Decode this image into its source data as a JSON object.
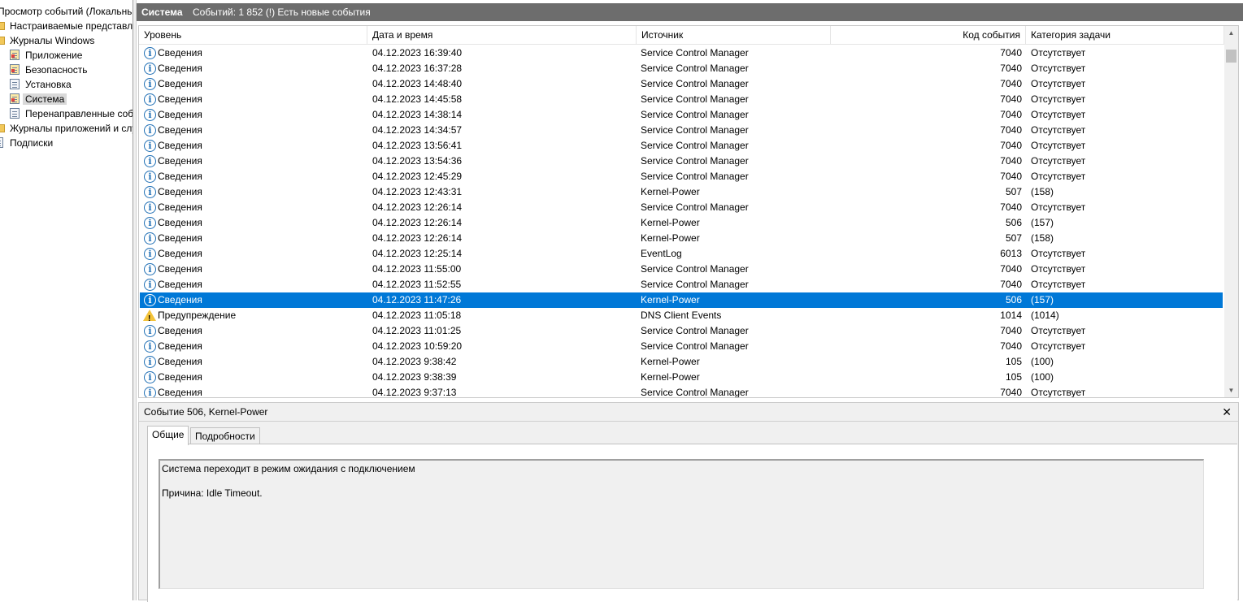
{
  "tree": {
    "root_label": "Просмотр событий (Локальный)",
    "items": [
      {
        "label": "Настраиваемые представления",
        "icon": "folder-icon"
      },
      {
        "label": "Журналы Windows",
        "icon": "folder-icon"
      },
      {
        "label": "Приложение",
        "icon": "log-icon"
      },
      {
        "label": "Безопасность",
        "icon": "log-icon"
      },
      {
        "label": "Установка",
        "icon": "log-icon"
      },
      {
        "label": "Система",
        "icon": "log-icon"
      },
      {
        "label": "Перенаправленные события",
        "icon": "log-icon"
      },
      {
        "label": "Журналы приложений и служб",
        "icon": "folder-icon"
      },
      {
        "label": "Подписки",
        "icon": "subscription-icon"
      }
    ]
  },
  "titlebar": {
    "log_name": "Система",
    "summary": "Событий: 1 852 (!) Есть новые события"
  },
  "grid": {
    "columns": [
      "Уровень",
      "Дата и время",
      "Источник",
      "Код события",
      "Категория задачи"
    ],
    "rows": [
      {
        "level": "Сведения",
        "type": "info",
        "date": "04.12.2023 16:39:40",
        "source": "Service Control Manager",
        "code": "7040",
        "category": "Отсутствует"
      },
      {
        "level": "Сведения",
        "type": "info",
        "date": "04.12.2023 16:37:28",
        "source": "Service Control Manager",
        "code": "7040",
        "category": "Отсутствует"
      },
      {
        "level": "Сведения",
        "type": "info",
        "date": "04.12.2023 14:48:40",
        "source": "Service Control Manager",
        "code": "7040",
        "category": "Отсутствует"
      },
      {
        "level": "Сведения",
        "type": "info",
        "date": "04.12.2023 14:45:58",
        "source": "Service Control Manager",
        "code": "7040",
        "category": "Отсутствует"
      },
      {
        "level": "Сведения",
        "type": "info",
        "date": "04.12.2023 14:38:14",
        "source": "Service Control Manager",
        "code": "7040",
        "category": "Отсутствует"
      },
      {
        "level": "Сведения",
        "type": "info",
        "date": "04.12.2023 14:34:57",
        "source": "Service Control Manager",
        "code": "7040",
        "category": "Отсутствует"
      },
      {
        "level": "Сведения",
        "type": "info",
        "date": "04.12.2023 13:56:41",
        "source": "Service Control Manager",
        "code": "7040",
        "category": "Отсутствует"
      },
      {
        "level": "Сведения",
        "type": "info",
        "date": "04.12.2023 13:54:36",
        "source": "Service Control Manager",
        "code": "7040",
        "category": "Отсутствует"
      },
      {
        "level": "Сведения",
        "type": "info",
        "date": "04.12.2023 12:45:29",
        "source": "Service Control Manager",
        "code": "7040",
        "category": "Отсутствует"
      },
      {
        "level": "Сведения",
        "type": "info",
        "date": "04.12.2023 12:43:31",
        "source": "Kernel-Power",
        "code": "507",
        "category": "(158)"
      },
      {
        "level": "Сведения",
        "type": "info",
        "date": "04.12.2023 12:26:14",
        "source": "Service Control Manager",
        "code": "7040",
        "category": "Отсутствует"
      },
      {
        "level": "Сведения",
        "type": "info",
        "date": "04.12.2023 12:26:14",
        "source": "Kernel-Power",
        "code": "506",
        "category": "(157)"
      },
      {
        "level": "Сведения",
        "type": "info",
        "date": "04.12.2023 12:26:14",
        "source": "Kernel-Power",
        "code": "507",
        "category": "(158)"
      },
      {
        "level": "Сведения",
        "type": "info",
        "date": "04.12.2023 12:25:14",
        "source": "EventLog",
        "code": "6013",
        "category": "Отсутствует"
      },
      {
        "level": "Сведения",
        "type": "info",
        "date": "04.12.2023 11:55:00",
        "source": "Service Control Manager",
        "code": "7040",
        "category": "Отсутствует"
      },
      {
        "level": "Сведения",
        "type": "info",
        "date": "04.12.2023 11:52:55",
        "source": "Service Control Manager",
        "code": "7040",
        "category": "Отсутствует"
      },
      {
        "level": "Сведения",
        "type": "info",
        "date": "04.12.2023 11:47:26",
        "source": "Kernel-Power",
        "code": "506",
        "category": "(157)",
        "selected": true
      },
      {
        "level": "Предупреждение",
        "type": "warning",
        "date": "04.12.2023 11:05:18",
        "source": "DNS Client Events",
        "code": "1014",
        "category": "(1014)"
      },
      {
        "level": "Сведения",
        "type": "info",
        "date": "04.12.2023 11:01:25",
        "source": "Service Control Manager",
        "code": "7040",
        "category": "Отсутствует"
      },
      {
        "level": "Сведения",
        "type": "info",
        "date": "04.12.2023 10:59:20",
        "source": "Service Control Manager",
        "code": "7040",
        "category": "Отсутствует"
      },
      {
        "level": "Сведения",
        "type": "info",
        "date": "04.12.2023 9:38:42",
        "source": "Kernel-Power",
        "code": "105",
        "category": "(100)"
      },
      {
        "level": "Сведения",
        "type": "info",
        "date": "04.12.2023 9:38:39",
        "source": "Kernel-Power",
        "code": "105",
        "category": "(100)"
      },
      {
        "level": "Сведения",
        "type": "info",
        "date": "04.12.2023 9:37:13",
        "source": "Service Control Manager",
        "code": "7040",
        "category": "Отсутствует"
      }
    ]
  },
  "detail": {
    "title": "Событие 506, Kernel-Power",
    "close_glyph": "✕",
    "tabs": [
      "Общие",
      "Подробности"
    ],
    "active_tab": 0,
    "message_line1": "Система переходит в режим ожидания с подключением",
    "message_line2": "Причина: Idle Timeout."
  },
  "colors": {
    "selection": "#0078d7",
    "titlebar": "#6d6d6d",
    "info_icon": "#1f6fb5",
    "warning_icon": "#f3c33a"
  }
}
